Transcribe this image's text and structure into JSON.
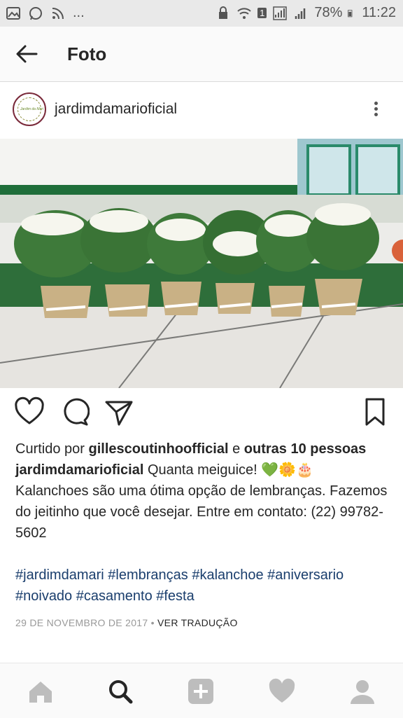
{
  "status_bar": {
    "dots": "...",
    "battery": "78%",
    "time": "11:22",
    "sim": "1"
  },
  "header": {
    "title": "Foto"
  },
  "post": {
    "username": "jardimdamarioficial",
    "avatar_text": "Jardim da Mari",
    "likes": {
      "prefix": "Curtido por ",
      "user": "gillescoutinhoofficial",
      "middle": " e ",
      "others": "outras 10 pessoas"
    },
    "caption_user": "jardimdamarioficial",
    "caption_text": " Quanta meiguice! 💚🌼🎂 Kalanchoes são uma ótima opção de lembranças. Fazemos do jeitinho que você desejar. Entre em contato: (22) 99782-5602",
    "hashtags": "#jardimdamari #lembranças #kalanchoe #aniversario #noivado #casamento #festa",
    "date": "29 DE NOVEMBRO DE 2017",
    "separator": " • ",
    "translate": "VER TRADUÇÃO"
  },
  "colors": {
    "accent_link": "#1a3e6d",
    "text": "#262626",
    "muted": "#999999"
  }
}
